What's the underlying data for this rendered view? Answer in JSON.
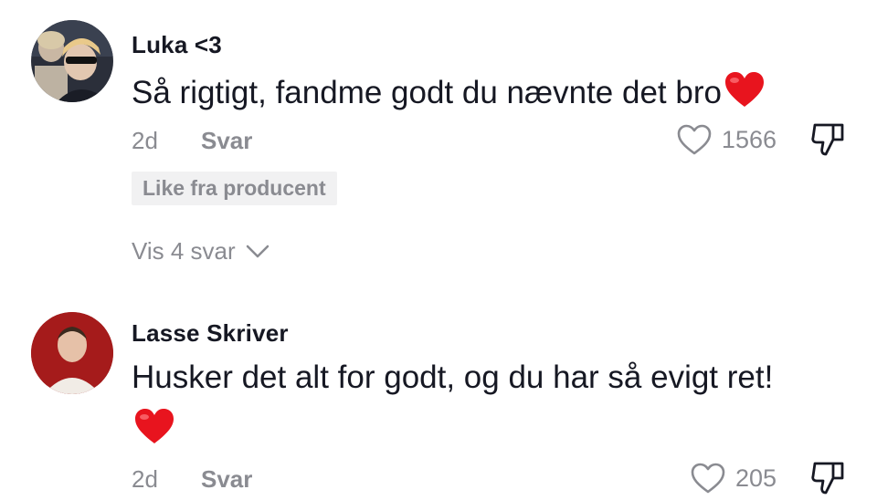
{
  "comments": [
    {
      "username": "Luka <3",
      "text": "Så rigtigt, fandme godt du nævnte det bro",
      "emoji": "red-heart",
      "age": "2d",
      "reply_label": "Svar",
      "likes": "1566",
      "creator_badge": "Like fra producent",
      "view_replies": "Vis 4 svar"
    },
    {
      "username": "Lasse Skriver",
      "text": "Husker det alt for godt, og du har så evigt ret!",
      "emoji": "red-heart",
      "age": "2d",
      "reply_label": "Svar",
      "likes": "205"
    }
  ],
  "icons": {
    "like": "heart-outline-icon",
    "dislike": "thumbs-down-icon",
    "expand": "chevron-down-icon",
    "emoji": "red-heart-emoji"
  },
  "colors": {
    "text_primary": "#161823",
    "text_secondary": "#8a8b91",
    "badge_background": "#f1f1f2",
    "emoji_heart": "#e8141e"
  }
}
